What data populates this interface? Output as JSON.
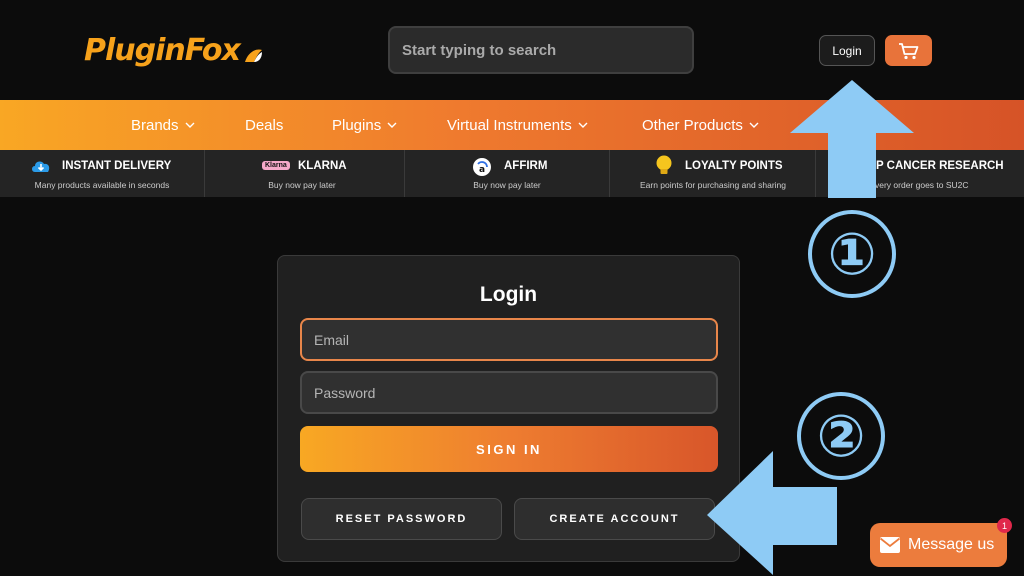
{
  "brand": {
    "logo_text": "PluginFox"
  },
  "header": {
    "search_placeholder": "Start typing to search",
    "login_label": "Login"
  },
  "nav": {
    "items": [
      {
        "label": "Brands",
        "has_dropdown": true
      },
      {
        "label": "Deals",
        "has_dropdown": false
      },
      {
        "label": "Plugins",
        "has_dropdown": true
      },
      {
        "label": "Virtual Instruments",
        "has_dropdown": true
      },
      {
        "label": "Other Products",
        "has_dropdown": true
      }
    ]
  },
  "features": [
    {
      "title": "INSTANT DELIVERY",
      "subtitle": "Many products available in seconds",
      "icon": "cloud-download-icon"
    },
    {
      "title": "KLARNA",
      "subtitle": "Buy now pay later",
      "icon": "klarna-badge",
      "badge_text": "Klarna"
    },
    {
      "title": "AFFIRM",
      "subtitle": "Buy now pay later",
      "icon": "affirm-icon"
    },
    {
      "title": "LOYALTY POINTS",
      "subtitle": "Earn points for purchasing and sharing",
      "icon": "lightbulb-icon"
    },
    {
      "title": "LP CANCER RESEARCH",
      "subtitle": "ge of every order goes to SU2C",
      "icon": "none"
    }
  ],
  "login_form": {
    "title": "Login",
    "email_placeholder": "Email",
    "password_placeholder": "Password",
    "signin_label": "SIGN IN",
    "reset_label": "RESET PASSWORD",
    "create_label": "CREATE ACCOUNT"
  },
  "annotations": {
    "step1": "①",
    "step2": "②"
  },
  "chat": {
    "label": "Message us",
    "badge_count": "1"
  },
  "colors": {
    "accent_orange": "#ef7a2e",
    "logo_orange": "#f7a21b",
    "annotation_blue": "#8ecbf5",
    "background": "#0c0c0c"
  }
}
